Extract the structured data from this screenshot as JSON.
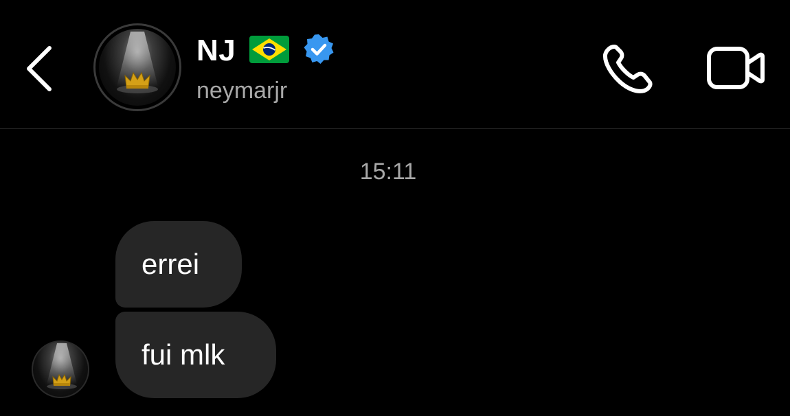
{
  "header": {
    "back_icon": "chevron-left-icon",
    "display_name": "NJ",
    "flag_icon": "brazil-flag-icon",
    "verified_icon": "verified-badge-icon",
    "username": "neymarjr",
    "call_icon": "phone-icon",
    "video_icon": "video-camera-icon"
  },
  "thread": {
    "timestamp": "15:11",
    "messages": [
      {
        "text": "errei"
      },
      {
        "text": "fui mlk"
      }
    ]
  },
  "colors": {
    "background": "#000000",
    "bubble": "#262626",
    "secondary_text": "#a8a8a8",
    "verified_blue": "#3897f0",
    "flag_green": "#009c3b",
    "flag_yellow": "#ffdf00",
    "flag_blue": "#002776"
  }
}
